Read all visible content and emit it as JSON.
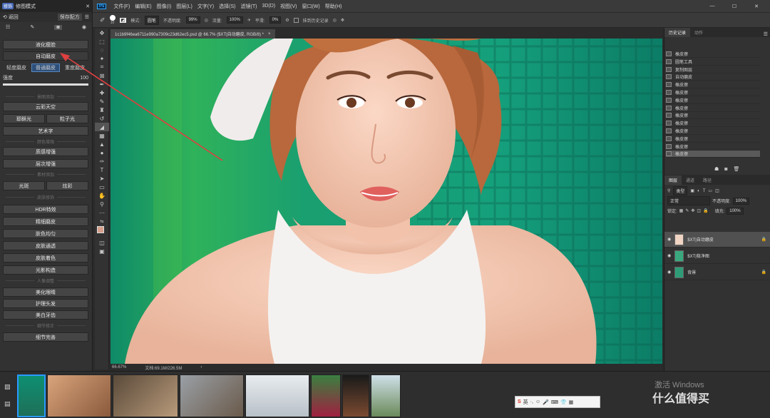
{
  "plugin": {
    "tag": "修饰",
    "title": "修图模式",
    "back": "返回",
    "save_config": "保存配方",
    "liquify": "液化瘦脸",
    "auto_smooth": "自动磨皮",
    "modes": [
      "轻度磨皮",
      "普通磨皮",
      "重度磨皮"
    ],
    "strength_label": "强度",
    "strength_value": "100",
    "sections": {
      "sky": "景图添加",
      "color": "颜色增强",
      "material": "素材添加",
      "skin": "皮肤修饰",
      "portrait": "人像调整",
      "detail": "细节修正"
    },
    "sky_btn": "云彩天空",
    "bokeh": "耶稣光",
    "particle": "粒子光",
    "art": "艺术字",
    "texture": "质感增强",
    "layer_boost": "层次增强",
    "glare": "光斑",
    "flare": "炫彩",
    "hdr": "HDR特效",
    "fine_smooth": "精细磨皮",
    "skin_even": "肤色均匀",
    "skin_clear": "皮肤通透",
    "skin_tone": "皮肤着色",
    "light_shape": "光影构造",
    "eyes": "美化眼睛",
    "hair": "护理头发",
    "teeth": "美白牙齿",
    "detail_btn": "细节完善"
  },
  "menubar": {
    "app_icon": "Ps",
    "items": [
      "文件(F)",
      "编辑(E)",
      "图像(I)",
      "图层(L)",
      "文字(Y)",
      "选择(S)",
      "滤镜(T)",
      "3D(D)",
      "视图(V)",
      "窗口(W)",
      "帮助(H)"
    ],
    "min": "—",
    "max": "☐",
    "close": "✕"
  },
  "options": {
    "brush_size": "10",
    "mode_label": "模式:",
    "mode": "圆笔",
    "opacity_label": "不透明度:",
    "opacity": "99%",
    "flow_label": "流量:",
    "flow": "100%",
    "smooth_label": "平滑:",
    "smooth": "0%",
    "history_label": "抹到历史记录"
  },
  "document": {
    "tab": "1c1b9f46ea6711e990a7309c23d62ec5.psd @ 66.7% ($XT|自动磨皮, RGB/8) *",
    "close": "×"
  },
  "status": {
    "zoom": "66.67%",
    "doc": "文档:69.1M/226.5M"
  },
  "history": {
    "tabs": [
      "历史记录",
      "动作"
    ],
    "items": [
      "橡皮擦",
      "圆笔工具",
      "复制图层",
      "自动磨皮",
      "橡皮擦",
      "橡皮擦",
      "橡皮擦",
      "橡皮擦",
      "橡皮擦",
      "橡皮擦",
      "橡皮擦",
      "橡皮擦",
      "橡皮擦",
      "橡皮擦"
    ]
  },
  "layers": {
    "tabs": [
      "图层",
      "通道",
      "路径"
    ],
    "kind_label": "类型",
    "blend": "正常",
    "opacity_label": "不透明度:",
    "opacity": "100%",
    "lock_label": "锁定:",
    "fill_label": "填充:",
    "fill": "100%",
    "items": [
      "$XT|自动磨皮",
      "$XT|稳净图",
      "背景"
    ]
  },
  "ime": {
    "label": "英"
  },
  "watermark": {
    "line1": "激活 Windows",
    "line2": "什么值得买"
  },
  "colors": {
    "accent": "#4a6bb8",
    "arrow": "#e04040"
  }
}
